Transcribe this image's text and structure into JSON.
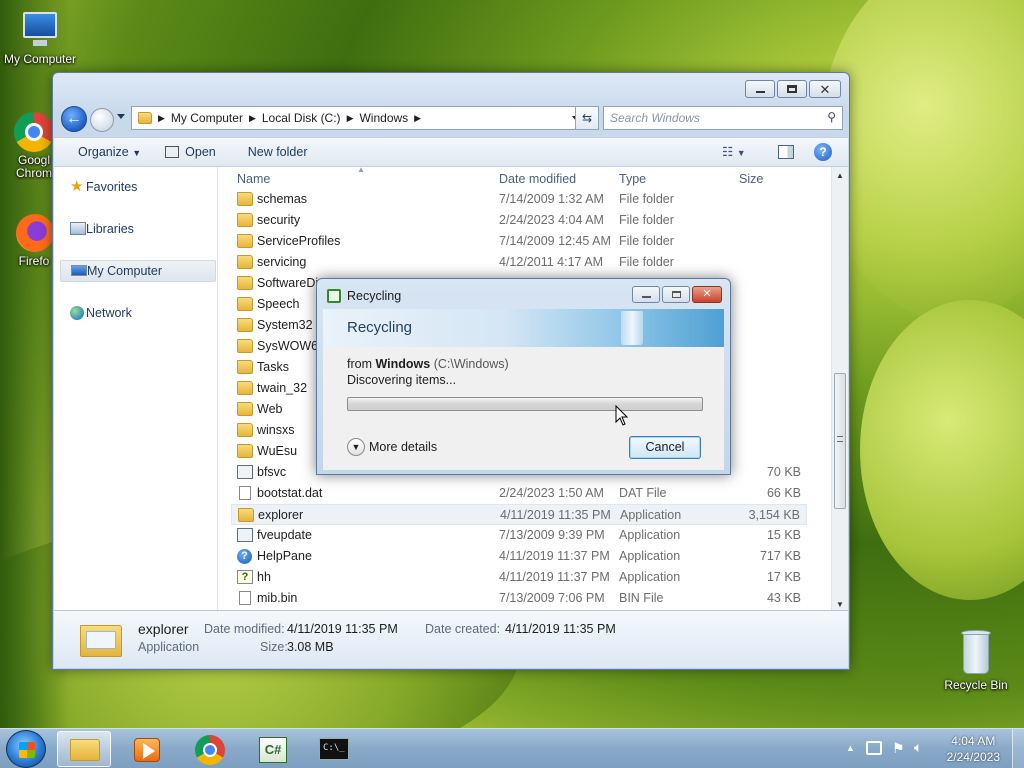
{
  "desktop": {
    "icons": [
      {
        "label": "My Computer",
        "icon": "computer-icon"
      },
      {
        "label": "Googl Chrom",
        "icon": "chrome-icon"
      },
      {
        "label": "Firefo",
        "icon": "firefox-icon"
      },
      {
        "label": "Recycle Bin",
        "icon": "recycle-bin-icon"
      }
    ]
  },
  "explorer": {
    "breadcrumb": [
      "My Computer",
      "Local Disk (C:)",
      "Windows"
    ],
    "search_placeholder": "Search Windows",
    "toolbar": {
      "organize": "Organize",
      "open": "Open",
      "new_folder": "New folder"
    },
    "nav": [
      {
        "label": "Favorites",
        "icon": "star-icon"
      },
      {
        "label": "Libraries",
        "icon": "library-icon"
      },
      {
        "label": "My Computer",
        "icon": "computer-icon"
      },
      {
        "label": "Network",
        "icon": "network-icon"
      }
    ],
    "columns": {
      "name": "Name",
      "date": "Date modified",
      "type": "Type",
      "size": "Size"
    },
    "files": [
      {
        "name": "schemas",
        "date": "7/14/2009 1:32 AM",
        "type": "File folder",
        "size": "",
        "kind": "folder"
      },
      {
        "name": "security",
        "date": "2/24/2023 4:04 AM",
        "type": "File folder",
        "size": "",
        "kind": "folder"
      },
      {
        "name": "ServiceProfiles",
        "date": "7/14/2009 12:45 AM",
        "type": "File folder",
        "size": "",
        "kind": "folder"
      },
      {
        "name": "servicing",
        "date": "4/12/2011 4:17 AM",
        "type": "File folder",
        "size": "",
        "kind": "folder"
      },
      {
        "name": "SoftwareDis",
        "date": "",
        "type": "",
        "size": "",
        "kind": "folder"
      },
      {
        "name": "Speech",
        "date": "",
        "type": "",
        "size": "",
        "kind": "folder"
      },
      {
        "name": "System32",
        "date": "",
        "type": "",
        "size": "",
        "kind": "folder"
      },
      {
        "name": "SysWOW64",
        "date": "",
        "type": "",
        "size": "",
        "kind": "folder"
      },
      {
        "name": "Tasks",
        "date": "",
        "type": "",
        "size": "",
        "kind": "folder"
      },
      {
        "name": "twain_32",
        "date": "",
        "type": "",
        "size": "",
        "kind": "folder"
      },
      {
        "name": "Web",
        "date": "",
        "type": "",
        "size": "",
        "kind": "folder"
      },
      {
        "name": "winsxs",
        "date": "",
        "type": "",
        "size": "",
        "kind": "folder"
      },
      {
        "name": "WuEsu",
        "date": "",
        "type": "",
        "size": "",
        "kind": "folder"
      },
      {
        "name": "bfsvc",
        "date": "",
        "type": "",
        "size": "70 KB",
        "kind": "app"
      },
      {
        "name": "bootstat.dat",
        "date": "2/24/2023 1:50 AM",
        "type": "DAT File",
        "size": "66 KB",
        "kind": "file"
      },
      {
        "name": "explorer",
        "date": "4/11/2019 11:35 PM",
        "type": "Application",
        "size": "3,154 KB",
        "kind": "explorer"
      },
      {
        "name": "fveupdate",
        "date": "7/13/2009 9:39 PM",
        "type": "Application",
        "size": "15 KB",
        "kind": "app"
      },
      {
        "name": "HelpPane",
        "date": "4/11/2019 11:37 PM",
        "type": "Application",
        "size": "717 KB",
        "kind": "help"
      },
      {
        "name": "hh",
        "date": "4/11/2019 11:37 PM",
        "type": "Application",
        "size": "17 KB",
        "kind": "hh"
      },
      {
        "name": "mib.bin",
        "date": "7/13/2009 7:06 PM",
        "type": "BIN File",
        "size": "43 KB",
        "kind": "file"
      }
    ],
    "details": {
      "name": "explorer",
      "kind": "Application",
      "date_modified_label": "Date modified:",
      "date_modified": "4/11/2019 11:35 PM",
      "date_created_label": "Date created:",
      "date_created": "4/11/2019 11:35 PM",
      "size_label": "Size:",
      "size": "3.08 MB"
    }
  },
  "dialog": {
    "title": "Recycling",
    "heading": "Recycling",
    "from_prefix": "from",
    "from_name": "Windows",
    "from_path": "(C:\\Windows)",
    "status": "Discovering items...",
    "progress": 0,
    "more_details": "More details",
    "cancel": "Cancel"
  },
  "taskbar": {
    "apps": [
      "explorer-icon",
      "media-player-icon",
      "chrome-icon",
      "csharp-icon",
      "cmd-icon"
    ],
    "time": "4:04 AM",
    "date": "2/24/2023"
  }
}
